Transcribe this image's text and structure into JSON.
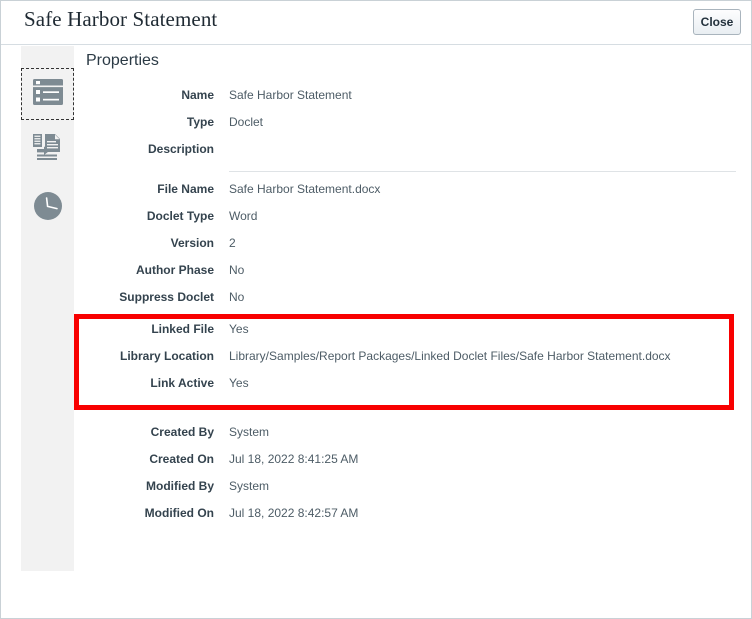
{
  "header": {
    "title": "Safe Harbor Statement",
    "close_label": "Close"
  },
  "sidebar": {
    "items": [
      {
        "name": "properties",
        "icon": "properties-list-icon",
        "selected": true
      },
      {
        "name": "references",
        "icon": "references-document-icon",
        "selected": false
      },
      {
        "name": "history",
        "icon": "history-clock-icon",
        "selected": false
      }
    ]
  },
  "properties": {
    "heading": "Properties",
    "groups": [
      {
        "id": "identity",
        "rows": [
          {
            "label": "Name",
            "value": "Safe Harbor Statement"
          },
          {
            "label": "Type",
            "value": "Doclet"
          },
          {
            "label": "Description",
            "value": ""
          }
        ]
      },
      {
        "id": "file",
        "rows": [
          {
            "label": "File Name",
            "value": "Safe Harbor Statement.docx"
          },
          {
            "label": "Doclet Type",
            "value": "Word"
          },
          {
            "label": "Version",
            "value": "2"
          },
          {
            "label": "Author Phase",
            "value": "No"
          },
          {
            "label": "Suppress Doclet",
            "value": "No"
          }
        ]
      },
      {
        "id": "link",
        "highlighted": true,
        "highlight_color": "#f80000",
        "rows": [
          {
            "label": "Linked File",
            "value": "Yes"
          },
          {
            "label": "Library Location",
            "value": "Library/Samples/Report Packages/Linked Doclet Files/Safe Harbor Statement.docx"
          },
          {
            "label": "Link Active",
            "value": "Yes"
          }
        ]
      },
      {
        "id": "audit",
        "rows": [
          {
            "label": "Created By",
            "value": "System"
          },
          {
            "label": "Created On",
            "value": "Jul 18, 2022 8:41:25 AM"
          },
          {
            "label": "Modified By",
            "value": "System"
          },
          {
            "label": "Modified On",
            "value": "Jul 18, 2022 8:42:57 AM"
          }
        ]
      }
    ]
  }
}
